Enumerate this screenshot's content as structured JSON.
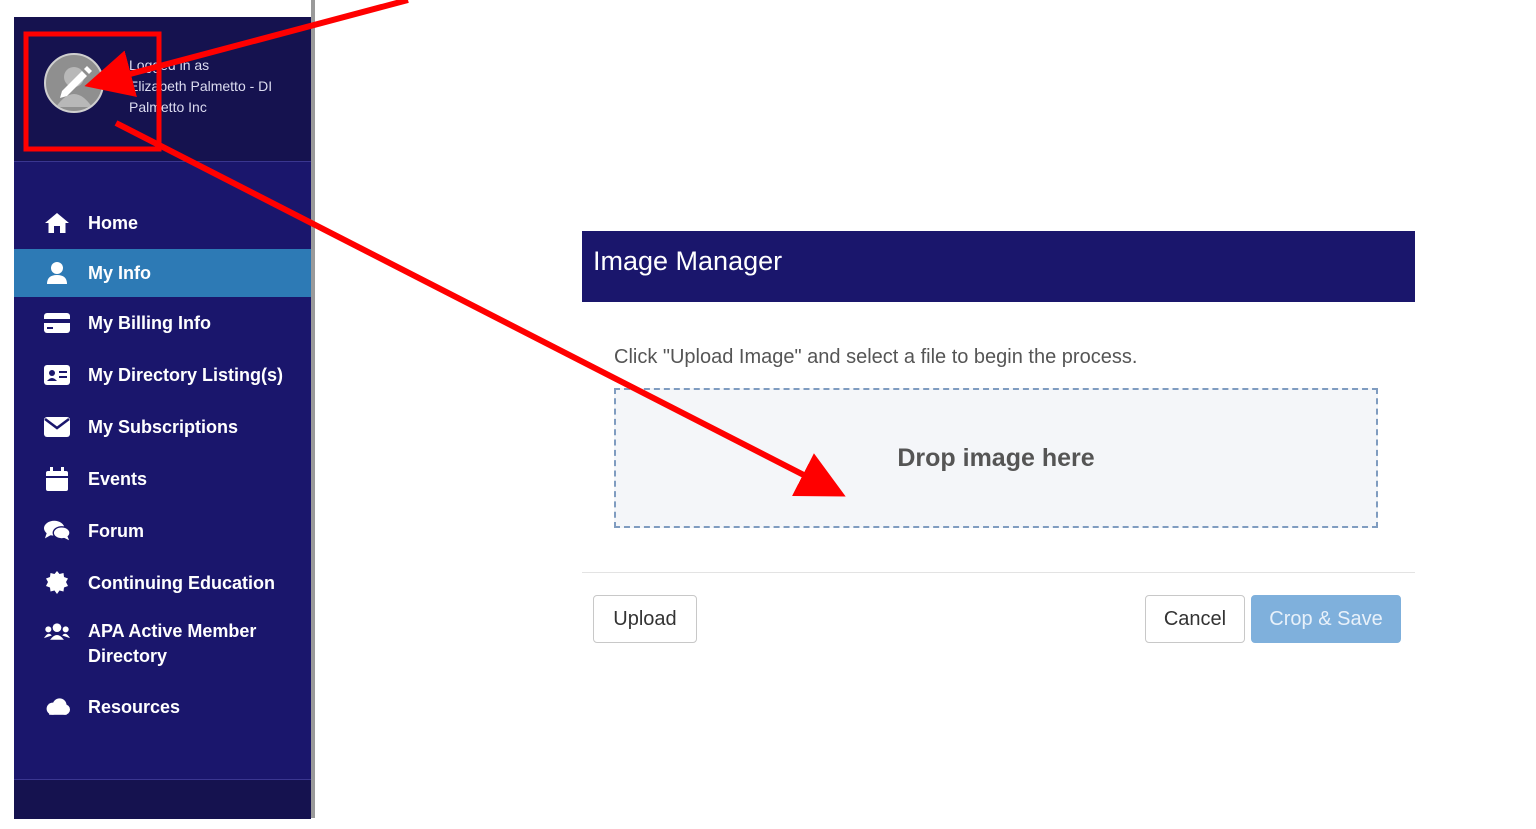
{
  "sidebar": {
    "profile": {
      "logged_in_label": "Logged in as",
      "user_name": "Elizabeth Palmetto - DI Palmetto Inc"
    },
    "items": [
      {
        "label": "Home",
        "icon": "home-icon",
        "active": false
      },
      {
        "label": "My Info",
        "icon": "user-icon",
        "active": true
      },
      {
        "label": "My Billing Info",
        "icon": "credit-card-icon",
        "active": false
      },
      {
        "label": "My Directory Listing(s)",
        "icon": "id-card-icon",
        "active": false
      },
      {
        "label": "My Subscriptions",
        "icon": "envelope-icon",
        "active": false
      },
      {
        "label": "Events",
        "icon": "calendar-icon",
        "active": false
      },
      {
        "label": "Forum",
        "icon": "comments-icon",
        "active": false
      },
      {
        "label": "Continuing Education",
        "icon": "certificate-icon",
        "active": false
      },
      {
        "label": "APA Active Member Directory",
        "icon": "users-icon",
        "active": false
      },
      {
        "label": "Resources",
        "icon": "cloud-icon",
        "active": false
      }
    ]
  },
  "modal": {
    "title": "Image Manager",
    "instructions": "Click \"Upload Image\" and select a file to begin the process.",
    "dropzone_label": "Drop image here",
    "buttons": {
      "upload": "Upload",
      "cancel": "Cancel",
      "crop_save": "Crop & Save"
    }
  },
  "colors": {
    "sidebar_bg": "#1a166c",
    "sidebar_active": "#2d7ab5",
    "modal_header": "#1a166c",
    "primary_button": "#7fb0dc",
    "annotation": "#ff0000"
  }
}
